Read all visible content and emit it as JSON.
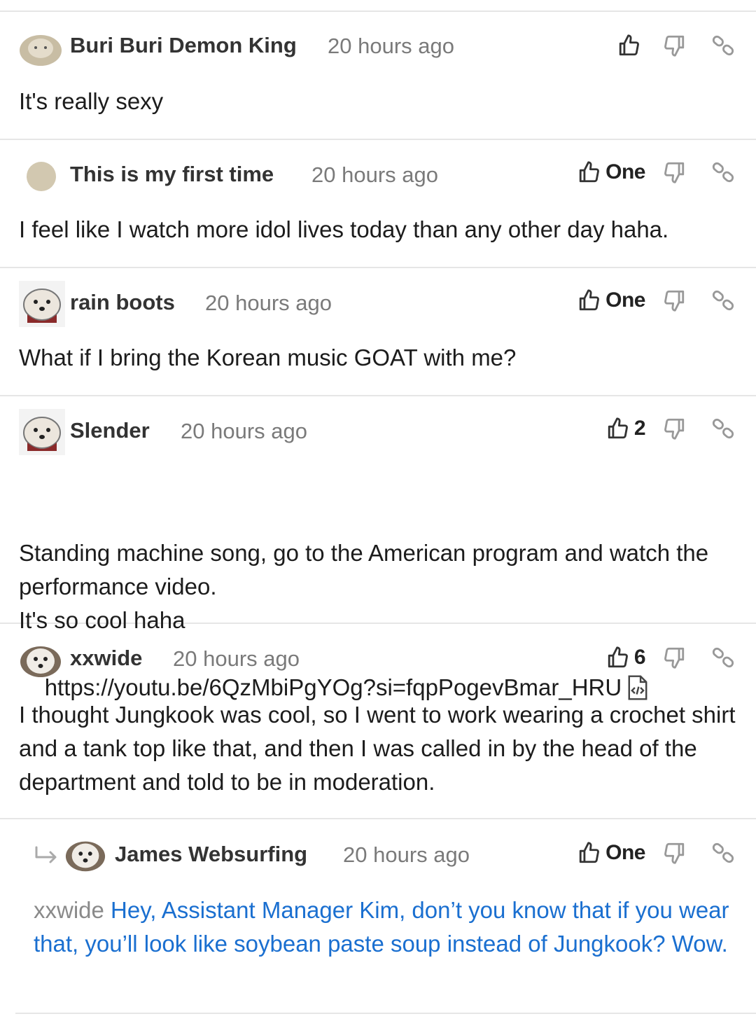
{
  "comments": [
    {
      "author": "Buri Buri Demon King",
      "time": "20 hours ago",
      "likes": "",
      "text": "It's really sexy"
    },
    {
      "author": "This is my first time",
      "time": "20 hours ago",
      "likes": "One",
      "text": "I feel like I watch more idol lives today than any other day haha."
    },
    {
      "author": "rain boots",
      "time": "20 hours ago",
      "likes": "One",
      "text": "What if I bring the Korean music GOAT with me?"
    },
    {
      "author": "Slender",
      "time": "20 hours ago",
      "likes": "2",
      "text": "Standing machine song, go to the American program and watch the performance video.\nIt's so cool haha",
      "url": "https://youtu.be/6QzMbiPgYOg?si=fqpPogevBmar_HRU"
    },
    {
      "author": "xxwide",
      "time": "20 hours ago",
      "likes": "6",
      "text": "I thought Jungkook was cool, so I went to work wearing a crochet shirt and a tank top like that, and then I was called in by the head of the department and told to be in moderation."
    }
  ],
  "reply": {
    "author": "James Websurfing",
    "time": "20 hours ago",
    "likes": "One",
    "mention": "xxwide",
    "text": "Hey, Assistant Manager Kim, don’t you know that if you wear that, you’ll look like soybean paste soup instead of Jungkook? Wow."
  },
  "colors": {
    "link_blue": "#1a6fd0",
    "muted": "#7a7a7a",
    "divider": "#e6e6e6"
  },
  "icons": [
    "thumbs-up-icon",
    "thumbs-down-icon",
    "link-icon",
    "embed-icon",
    "reply-arrow-icon"
  ]
}
